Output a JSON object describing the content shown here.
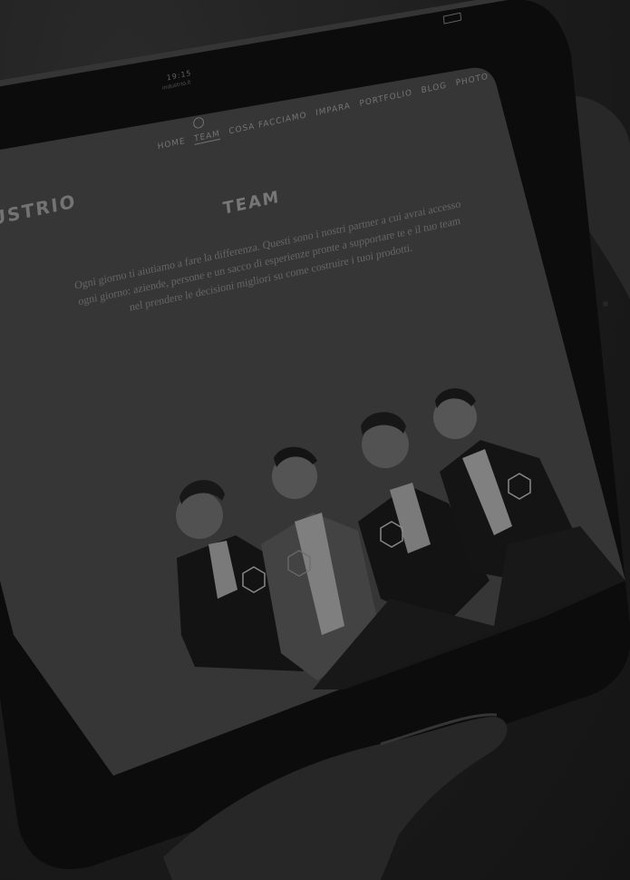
{
  "device": {
    "status_time": "19:15",
    "status_url": "industrio.it"
  },
  "site": {
    "brand": "USTRIO",
    "nav": [
      {
        "label": "HOME"
      },
      {
        "label": "TEAM"
      },
      {
        "label": "COSA FACCIAMO"
      },
      {
        "label": "IMPARA"
      },
      {
        "label": "PORTFOLIO"
      },
      {
        "label": "BLOG"
      },
      {
        "label": "PHOTO"
      }
    ],
    "page_title": "TEAM",
    "intro_text": "Ogni giorno ti aiutiamo a fare la differenza. Questi sono i nostri partner a cui avrai accesso ogni giorno: aziende, persone e un sacco di esperienze pronte a supportare te e il tuo team nel prendere le decisioni migliori su come costruire i tuoi prodotti."
  },
  "colors": {
    "overlay": "#1f1f1f",
    "screen": "#3a3a3a",
    "bezel": "#0d0d0d"
  }
}
